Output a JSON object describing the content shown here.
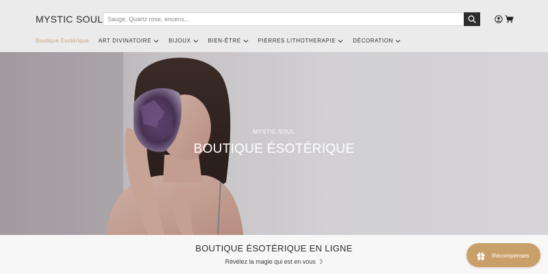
{
  "header": {
    "logo": "MYSTIC SOUL",
    "search": {
      "placeholder": "Sauge, Quartz rose, encens..."
    },
    "icons": [
      "search-icon",
      "user-icon",
      "cart-icon"
    ]
  },
  "nav": {
    "items": [
      {
        "label": "Boutique Esotérique",
        "dropdown": false
      },
      {
        "label": "ART DIVINATOIRE",
        "dropdown": true
      },
      {
        "label": "BIJOUX",
        "dropdown": true
      },
      {
        "label": "BIEN-ÊTRE",
        "dropdown": true
      },
      {
        "label": "PIERRES LITHOTHERAPIE",
        "dropdown": true
      },
      {
        "label": "DÉCORATION",
        "dropdown": true
      }
    ]
  },
  "hero": {
    "subtitle": "MYSTIC SOUL",
    "title": "BOUTIQUE ÉSOTÉRIQUE"
  },
  "intro": {
    "title": "BOUTIQUE ÉSOTÉRIQUE EN LIGNE",
    "subtitle": "Révélez la magie qui est en vous ☽"
  },
  "rewards": {
    "label": "Récompenses"
  },
  "colors": {
    "header_bg": "#ebebeb",
    "accent_gold": "#c9a27a",
    "rewards_bg": "#c9a06a",
    "search_button": "#2d2d2d"
  }
}
